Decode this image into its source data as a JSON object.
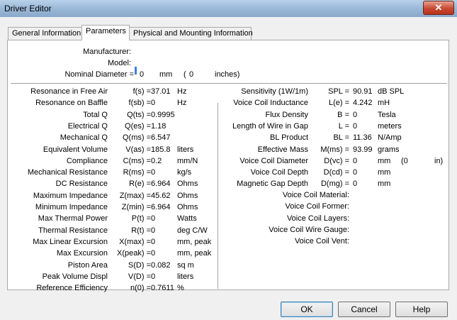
{
  "window": {
    "title": "Driver Editor",
    "close": "✕"
  },
  "tabs": [
    "General Information",
    "Parameters",
    "Physical and Mounting Information"
  ],
  "header": {
    "manufacturer_label": "Manufacturer:",
    "model_label": "Model:",
    "nominal_label": "Nominal Diameter =",
    "nominal_value": "0",
    "nominal_unit": "mm",
    "inches_open": "(",
    "inches_value": "0",
    "inches_unit": "inches)"
  },
  "left_params": [
    {
      "name": "Resonance in Free Air",
      "sym": "f(s) =",
      "value": "37.01",
      "unit": "Hz"
    },
    {
      "name": "Resonance on Baffle",
      "sym": "f(sb) =",
      "value": "0",
      "unit": "Hz"
    },
    {
      "name": "Total Q",
      "sym": "Q(ts) =",
      "value": "0.9995",
      "unit": ""
    },
    {
      "name": "Electrical Q",
      "sym": "Q(es) =",
      "value": "1.18",
      "unit": ""
    },
    {
      "name": "Mechanical Q",
      "sym": "Q(ms) =",
      "value": "6.547",
      "unit": ""
    },
    {
      "name": "Equivalent Volume",
      "sym": "V(as) =",
      "value": "185.8",
      "unit": "liters"
    },
    {
      "name": "Compliance",
      "sym": "C(ms) =",
      "value": "0.2",
      "unit": "mm/N"
    },
    {
      "name": "Mechanical Resistance",
      "sym": "R(ms) =",
      "value": "0",
      "unit": "kg/s"
    },
    {
      "name": "DC Resistance",
      "sym": "R(e) =",
      "value": "6.964",
      "unit": "Ohms"
    },
    {
      "name": "Maximum Impedance",
      "sym": "Z(max) =",
      "value": "45.62",
      "unit": "Ohms"
    },
    {
      "name": "Minimum Impedance",
      "sym": "Z(min) =",
      "value": "6.964",
      "unit": "Ohms"
    },
    {
      "name": "Max Thermal Power",
      "sym": "P(t) =",
      "value": "0",
      "unit": "Watts"
    },
    {
      "name": "Thermal Resistance",
      "sym": "R(t) =",
      "value": "0",
      "unit": "deg C/W"
    },
    {
      "name": "Max Linear Excursion",
      "sym": "X(max) =",
      "value": "0",
      "unit": "mm, peak"
    },
    {
      "name": "Max Excursion",
      "sym": "X(peak) =",
      "value": "0",
      "unit": "mm, peak"
    },
    {
      "name": "Piston Area",
      "sym": "S(D) =",
      "value": "0.082",
      "unit": "sq m"
    },
    {
      "name": "Peak Volume Displ",
      "sym": "V(D) =",
      "value": "0",
      "unit": "liters"
    },
    {
      "name": "Reference Efficiency",
      "sym": "n(0) =",
      "value": "0.7611",
      "unit": "%"
    }
  ],
  "right_params": [
    {
      "name": "Sensitivity (1W/1m)",
      "sym": "SPL =",
      "value": "90.91",
      "unit": "dB SPL"
    },
    {
      "name": "Voice Coil Inductance",
      "sym": "L(e) =",
      "value": "4.242",
      "unit": "mH"
    },
    {
      "name": "Flux Density",
      "sym": "B =",
      "value": "0",
      "unit": "Tesla"
    },
    {
      "name": "Length of Wire in Gap",
      "sym": "L =",
      "value": "0",
      "unit": "meters"
    },
    {
      "name": "BL Product",
      "sym": "BL =",
      "value": "11.36",
      "unit": "N/Amp"
    },
    {
      "name": "Effective Mass",
      "sym": "M(ms) =",
      "value": "93.99",
      "unit": "grams"
    },
    {
      "name": "Voice Coil Diameter",
      "sym": "D(vc) =",
      "value": "0",
      "unit": "mm"
    },
    {
      "name": "Voice Coil Depth",
      "sym": "D(cd) =",
      "value": "0",
      "unit": "mm"
    },
    {
      "name": "Magnetic Gap Depth",
      "sym": "D(mg) =",
      "value": "0",
      "unit": "mm"
    }
  ],
  "vc_extra": {
    "open": "(0",
    "unit": "in)"
  },
  "vc_info": [
    "Voice Coil Material:",
    "Voice Coil Former:",
    "Voice Coil Layers:",
    "Voice Coil Wire Gauge:",
    "Voice Coil Vent:"
  ],
  "buttons": {
    "ok": "OK",
    "cancel": "Cancel",
    "help": "Help"
  }
}
